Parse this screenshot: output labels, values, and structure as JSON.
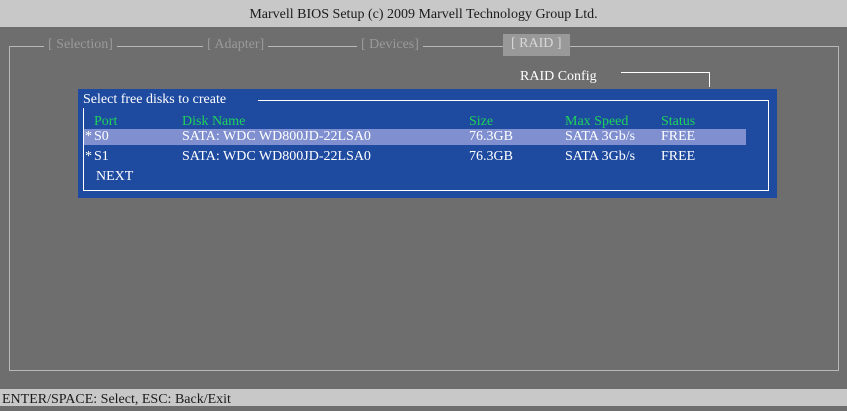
{
  "title": "Marvell BIOS Setup (c) 2009 Marvell Technology Group Ltd.",
  "tabs": [
    {
      "label": "[ Selection]"
    },
    {
      "label": "[ Adapter]"
    },
    {
      "label": "[ Devices]"
    },
    {
      "label": "[ RAID ]"
    }
  ],
  "active_tab": "[ RAID ]",
  "raid_config_label": "RAID Config",
  "panel": {
    "title": "Select free disks to create",
    "columns": {
      "port": "Port",
      "disk_name": "Disk Name",
      "size": "Size",
      "max_speed": "Max Speed",
      "status": "Status"
    },
    "rows": [
      {
        "marker": "*",
        "port": "S0",
        "disk_name": "SATA: WDC WD800JD-22LSA0",
        "size": "76.3GB",
        "max_speed": "SATA 3Gb/s",
        "status": "FREE",
        "selected": true
      },
      {
        "marker": "*",
        "port": "S1",
        "disk_name": "SATA: WDC WD800JD-22LSA0",
        "size": "76.3GB",
        "max_speed": "SATA 3Gb/s",
        "status": "FREE",
        "selected": false
      }
    ],
    "next_label": "NEXT"
  },
  "status_bar": "ENTER/SPACE: Select, ESC: Back/Exit",
  "colors": {
    "background": "#6e6e6e",
    "panel": "#1e4aa0",
    "selected_row": "#7f8fd0",
    "header_text": "#1fd45a"
  }
}
